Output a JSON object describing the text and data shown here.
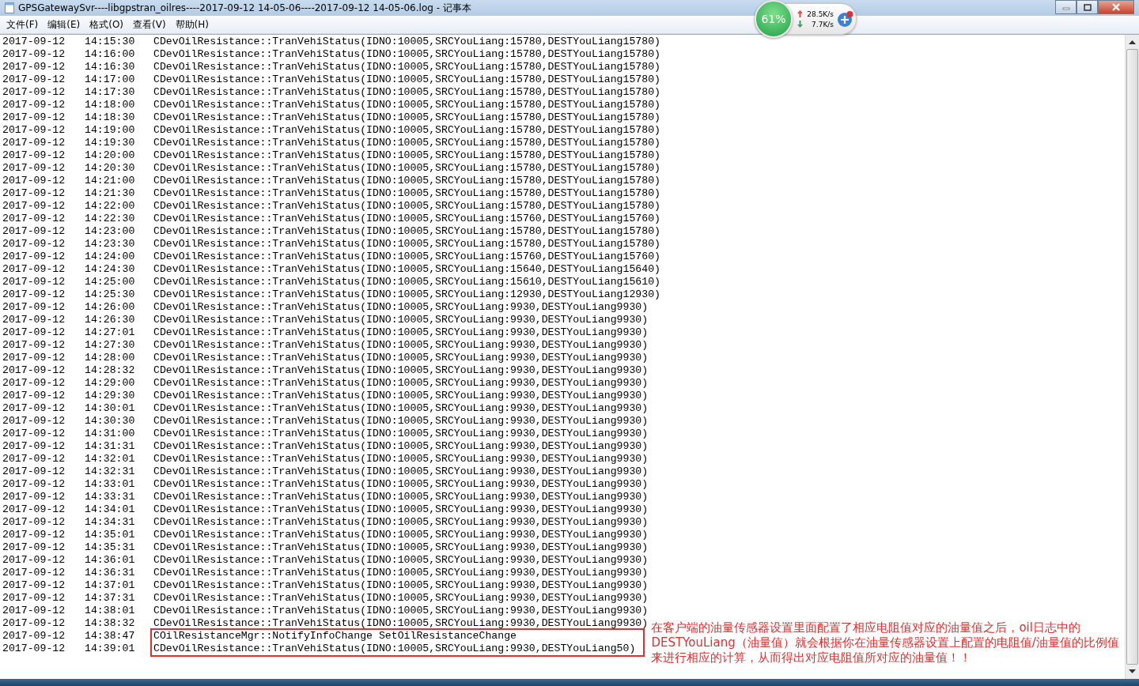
{
  "window": {
    "title": "GPSGatewaySvr----libgpstran_oilres----2017-09-12 14-05-06----2017-09-12 14-05-06.log - 记事本"
  },
  "menu": [
    "文件(F)",
    "编辑(E)",
    "格式(O)",
    "查看(V)",
    "帮助(H)"
  ],
  "speed_widget": {
    "percent": "61%",
    "upload": "28.5K/s",
    "download": "7.7K/s"
  },
  "log_lines": [
    {
      "date": "2017-09-12",
      "time": "14:15:30",
      "message": "CDevOilResistance::TranVehiStatus(IDNO:10005,SRCYouLiang:15780,DESTYouLiang15780)"
    },
    {
      "date": "2017-09-12",
      "time": "14:16:00",
      "message": "CDevOilResistance::TranVehiStatus(IDNO:10005,SRCYouLiang:15780,DESTYouLiang15780)"
    },
    {
      "date": "2017-09-12",
      "time": "14:16:30",
      "message": "CDevOilResistance::TranVehiStatus(IDNO:10005,SRCYouLiang:15780,DESTYouLiang15780)"
    },
    {
      "date": "2017-09-12",
      "time": "14:17:00",
      "message": "CDevOilResistance::TranVehiStatus(IDNO:10005,SRCYouLiang:15780,DESTYouLiang15780)"
    },
    {
      "date": "2017-09-12",
      "time": "14:17:30",
      "message": "CDevOilResistance::TranVehiStatus(IDNO:10005,SRCYouLiang:15780,DESTYouLiang15780)"
    },
    {
      "date": "2017-09-12",
      "time": "14:18:00",
      "message": "CDevOilResistance::TranVehiStatus(IDNO:10005,SRCYouLiang:15780,DESTYouLiang15780)"
    },
    {
      "date": "2017-09-12",
      "time": "14:18:30",
      "message": "CDevOilResistance::TranVehiStatus(IDNO:10005,SRCYouLiang:15780,DESTYouLiang15780)"
    },
    {
      "date": "2017-09-12",
      "time": "14:19:00",
      "message": "CDevOilResistance::TranVehiStatus(IDNO:10005,SRCYouLiang:15780,DESTYouLiang15780)"
    },
    {
      "date": "2017-09-12",
      "time": "14:19:30",
      "message": "CDevOilResistance::TranVehiStatus(IDNO:10005,SRCYouLiang:15780,DESTYouLiang15780)"
    },
    {
      "date": "2017-09-12",
      "time": "14:20:00",
      "message": "CDevOilResistance::TranVehiStatus(IDNO:10005,SRCYouLiang:15780,DESTYouLiang15780)"
    },
    {
      "date": "2017-09-12",
      "time": "14:20:30",
      "message": "CDevOilResistance::TranVehiStatus(IDNO:10005,SRCYouLiang:15780,DESTYouLiang15780)"
    },
    {
      "date": "2017-09-12",
      "time": "14:21:00",
      "message": "CDevOilResistance::TranVehiStatus(IDNO:10005,SRCYouLiang:15780,DESTYouLiang15780)"
    },
    {
      "date": "2017-09-12",
      "time": "14:21:30",
      "message": "CDevOilResistance::TranVehiStatus(IDNO:10005,SRCYouLiang:15780,DESTYouLiang15780)"
    },
    {
      "date": "2017-09-12",
      "time": "14:22:00",
      "message": "CDevOilResistance::TranVehiStatus(IDNO:10005,SRCYouLiang:15780,DESTYouLiang15780)"
    },
    {
      "date": "2017-09-12",
      "time": "14:22:30",
      "message": "CDevOilResistance::TranVehiStatus(IDNO:10005,SRCYouLiang:15760,DESTYouLiang15760)"
    },
    {
      "date": "2017-09-12",
      "time": "14:23:00",
      "message": "CDevOilResistance::TranVehiStatus(IDNO:10005,SRCYouLiang:15780,DESTYouLiang15780)"
    },
    {
      "date": "2017-09-12",
      "time": "14:23:30",
      "message": "CDevOilResistance::TranVehiStatus(IDNO:10005,SRCYouLiang:15780,DESTYouLiang15780)"
    },
    {
      "date": "2017-09-12",
      "time": "14:24:00",
      "message": "CDevOilResistance::TranVehiStatus(IDNO:10005,SRCYouLiang:15760,DESTYouLiang15760)"
    },
    {
      "date": "2017-09-12",
      "time": "14:24:30",
      "message": "CDevOilResistance::TranVehiStatus(IDNO:10005,SRCYouLiang:15640,DESTYouLiang15640)"
    },
    {
      "date": "2017-09-12",
      "time": "14:25:00",
      "message": "CDevOilResistance::TranVehiStatus(IDNO:10005,SRCYouLiang:15610,DESTYouLiang15610)"
    },
    {
      "date": "2017-09-12",
      "time": "14:25:30",
      "message": "CDevOilResistance::TranVehiStatus(IDNO:10005,SRCYouLiang:12930,DESTYouLiang12930)"
    },
    {
      "date": "2017-09-12",
      "time": "14:26:00",
      "message": "CDevOilResistance::TranVehiStatus(IDNO:10005,SRCYouLiang:9930,DESTYouLiang9930)"
    },
    {
      "date": "2017-09-12",
      "time": "14:26:30",
      "message": "CDevOilResistance::TranVehiStatus(IDNO:10005,SRCYouLiang:9930,DESTYouLiang9930)"
    },
    {
      "date": "2017-09-12",
      "time": "14:27:01",
      "message": "CDevOilResistance::TranVehiStatus(IDNO:10005,SRCYouLiang:9930,DESTYouLiang9930)"
    },
    {
      "date": "2017-09-12",
      "time": "14:27:30",
      "message": "CDevOilResistance::TranVehiStatus(IDNO:10005,SRCYouLiang:9930,DESTYouLiang9930)"
    },
    {
      "date": "2017-09-12",
      "time": "14:28:00",
      "message": "CDevOilResistance::TranVehiStatus(IDNO:10005,SRCYouLiang:9930,DESTYouLiang9930)"
    },
    {
      "date": "2017-09-12",
      "time": "14:28:32",
      "message": "CDevOilResistance::TranVehiStatus(IDNO:10005,SRCYouLiang:9930,DESTYouLiang9930)"
    },
    {
      "date": "2017-09-12",
      "time": "14:29:00",
      "message": "CDevOilResistance::TranVehiStatus(IDNO:10005,SRCYouLiang:9930,DESTYouLiang9930)"
    },
    {
      "date": "2017-09-12",
      "time": "14:29:30",
      "message": "CDevOilResistance::TranVehiStatus(IDNO:10005,SRCYouLiang:9930,DESTYouLiang9930)"
    },
    {
      "date": "2017-09-12",
      "time": "14:30:01",
      "message": "CDevOilResistance::TranVehiStatus(IDNO:10005,SRCYouLiang:9930,DESTYouLiang9930)"
    },
    {
      "date": "2017-09-12",
      "time": "14:30:30",
      "message": "CDevOilResistance::TranVehiStatus(IDNO:10005,SRCYouLiang:9930,DESTYouLiang9930)"
    },
    {
      "date": "2017-09-12",
      "time": "14:31:00",
      "message": "CDevOilResistance::TranVehiStatus(IDNO:10005,SRCYouLiang:9930,DESTYouLiang9930)"
    },
    {
      "date": "2017-09-12",
      "time": "14:31:31",
      "message": "CDevOilResistance::TranVehiStatus(IDNO:10005,SRCYouLiang:9930,DESTYouLiang9930)"
    },
    {
      "date": "2017-09-12",
      "time": "14:32:01",
      "message": "CDevOilResistance::TranVehiStatus(IDNO:10005,SRCYouLiang:9930,DESTYouLiang9930)"
    },
    {
      "date": "2017-09-12",
      "time": "14:32:31",
      "message": "CDevOilResistance::TranVehiStatus(IDNO:10005,SRCYouLiang:9930,DESTYouLiang9930)"
    },
    {
      "date": "2017-09-12",
      "time": "14:33:01",
      "message": "CDevOilResistance::TranVehiStatus(IDNO:10005,SRCYouLiang:9930,DESTYouLiang9930)"
    },
    {
      "date": "2017-09-12",
      "time": "14:33:31",
      "message": "CDevOilResistance::TranVehiStatus(IDNO:10005,SRCYouLiang:9930,DESTYouLiang9930)"
    },
    {
      "date": "2017-09-12",
      "time": "14:34:01",
      "message": "CDevOilResistance::TranVehiStatus(IDNO:10005,SRCYouLiang:9930,DESTYouLiang9930)"
    },
    {
      "date": "2017-09-12",
      "time": "14:34:31",
      "message": "CDevOilResistance::TranVehiStatus(IDNO:10005,SRCYouLiang:9930,DESTYouLiang9930)"
    },
    {
      "date": "2017-09-12",
      "time": "14:35:01",
      "message": "CDevOilResistance::TranVehiStatus(IDNO:10005,SRCYouLiang:9930,DESTYouLiang9930)"
    },
    {
      "date": "2017-09-12",
      "time": "14:35:31",
      "message": "CDevOilResistance::TranVehiStatus(IDNO:10005,SRCYouLiang:9930,DESTYouLiang9930)"
    },
    {
      "date": "2017-09-12",
      "time": "14:36:01",
      "message": "CDevOilResistance::TranVehiStatus(IDNO:10005,SRCYouLiang:9930,DESTYouLiang9930)"
    },
    {
      "date": "2017-09-12",
      "time": "14:36:31",
      "message": "CDevOilResistance::TranVehiStatus(IDNO:10005,SRCYouLiang:9930,DESTYouLiang9930)"
    },
    {
      "date": "2017-09-12",
      "time": "14:37:01",
      "message": "CDevOilResistance::TranVehiStatus(IDNO:10005,SRCYouLiang:9930,DESTYouLiang9930)"
    },
    {
      "date": "2017-09-12",
      "time": "14:37:31",
      "message": "CDevOilResistance::TranVehiStatus(IDNO:10005,SRCYouLiang:9930,DESTYouLiang9930)"
    },
    {
      "date": "2017-09-12",
      "time": "14:38:01",
      "message": "CDevOilResistance::TranVehiStatus(IDNO:10005,SRCYouLiang:9930,DESTYouLiang9930)"
    },
    {
      "date": "2017-09-12",
      "time": "14:38:32",
      "message": "CDevOilResistance::TranVehiStatus(IDNO:10005,SRCYouLiang:9930,DESTYouLiang9930)"
    }
  ],
  "highlighted_lines": [
    {
      "date": "2017-09-12",
      "time": "14:38:47",
      "message": "COilResistanceMgr::NotifyInfoChange SetOilResistanceChange"
    },
    {
      "date": "2017-09-12",
      "time": "14:39:01",
      "message": "CDevOilResistance::TranVehiStatus(IDNO:10005,SRCYouLiang:9930,DESTYouLiang50)"
    }
  ],
  "annotation": "在客户端的油量传感器设置里面配置了相应电阻值对应的油量值之后，oil日志中的DESTYouLiang（油量值）就会根据你在油量传感器设置上配置的电阻值/油量值的比例值来进行相应的计算，从而得出对应电阻值所对应的油量值！！"
}
